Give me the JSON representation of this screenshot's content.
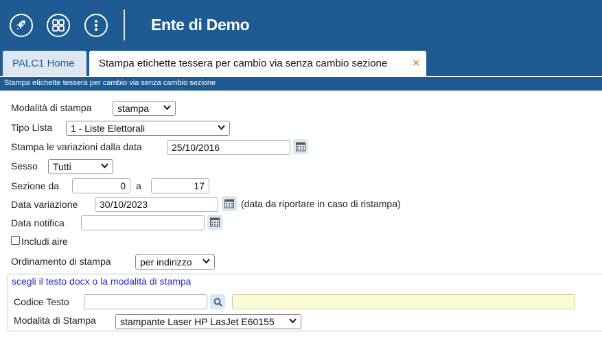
{
  "header": {
    "title": "Ente di Demo",
    "icons": [
      "rocket-icon",
      "grid-icon",
      "more-vertical-icon"
    ]
  },
  "tabs": [
    {
      "label": "PALC1 Home"
    },
    {
      "label": "Stampa etichette tessera per cambio via senza cambio sezione",
      "close": "×"
    }
  ],
  "subtitle": "Stampa etichette tessera per cambio via senza cambio sezione",
  "form": {
    "modalita_label": "Modalità di stampa",
    "modalita_value": "stampa",
    "tipo_lista_label": "Tipo Lista",
    "tipo_lista_value": "1 - Liste Elettorali",
    "variazioni_label": "Stampa le variazioni dalla data",
    "variazioni_value": "25/10/2016",
    "sesso_label": "Sesso",
    "sesso_value": "Tutti",
    "sezione_label": "Sezione da",
    "sezione_from": "0",
    "sezione_a": "a",
    "sezione_to": "17",
    "data_variazione_label": "Data variazione",
    "data_variazione_value": "30/10/2023",
    "data_variazione_note": "(data da riportare in caso di ristampa)",
    "data_notifica_label": "Data notifica",
    "data_notifica_value": "",
    "includi_aire_label": "Includi aire",
    "includi_aire_checked": false,
    "ordinamento_label": "Ordinamento di stampa",
    "ordinamento_value": "per indirizzo"
  },
  "section": {
    "legend": "scegli il testo docx o la modalità di stampa",
    "codice_label": "Codice Testo",
    "codice_value": "",
    "descrizione_value": "",
    "modalita_stampa_label": "Modalità di Stampa",
    "modalita_stampa_value": "stampante Laser HP LasJet E60155"
  },
  "colors": {
    "header_bg": "#1f5b93",
    "tab_inactive_bg": "#dde7f2",
    "close_icon": "#f08a3c",
    "legend_text": "#2a2acf",
    "description_bg": "#fbfbd9"
  }
}
